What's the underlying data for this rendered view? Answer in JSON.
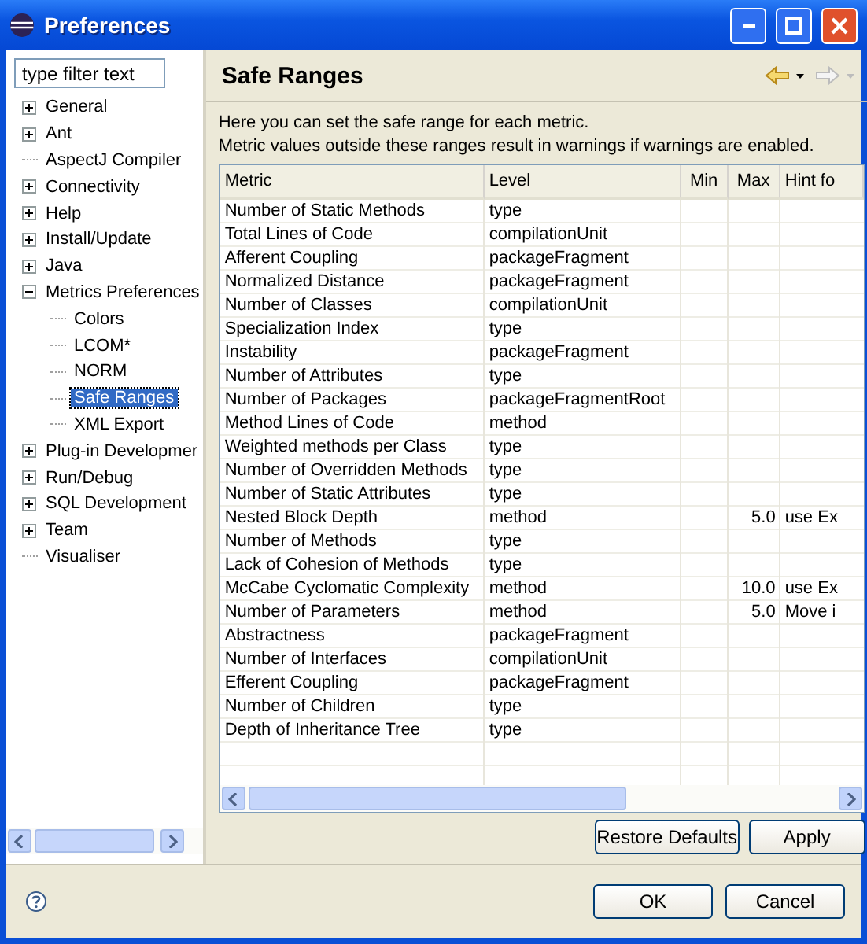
{
  "window": {
    "title": "Preferences"
  },
  "filter": {
    "placeholder": "type filter text"
  },
  "tree": [
    {
      "label": "General",
      "expanded": false,
      "selected": false
    },
    {
      "label": "Ant",
      "expanded": false,
      "selected": false
    },
    {
      "label": "AspectJ Compiler",
      "selected": false
    },
    {
      "label": "Connectivity",
      "expanded": false,
      "selected": false
    },
    {
      "label": "Help",
      "expanded": false,
      "selected": false
    },
    {
      "label": "Install/Update",
      "expanded": false,
      "selected": false
    },
    {
      "label": "Java",
      "expanded": false,
      "selected": false
    },
    {
      "label": "Metrics Preferences",
      "expanded": true,
      "selected": false,
      "children": [
        {
          "label": "Colors",
          "selected": false
        },
        {
          "label": "LCOM*",
          "selected": false
        },
        {
          "label": "NORM",
          "selected": false
        },
        {
          "label": "Safe Ranges",
          "selected": true
        },
        {
          "label": "XML Export",
          "selected": false
        }
      ]
    },
    {
      "label": "Plug-in Developmer",
      "expanded": false,
      "selected": false
    },
    {
      "label": "Run/Debug",
      "expanded": false,
      "selected": false
    },
    {
      "label": "SQL Development",
      "expanded": false,
      "selected": false
    },
    {
      "label": "Team",
      "expanded": false,
      "selected": false
    },
    {
      "label": "Visualiser",
      "selected": false
    }
  ],
  "page": {
    "title": "Safe Ranges",
    "description": [
      "Here you can set the safe range for each metric.",
      "Metric values outside these ranges result in warnings if warnings are enabled."
    ]
  },
  "table": {
    "columns": [
      "Metric",
      "Level",
      "Min",
      "Max",
      "Hint fo"
    ],
    "rows": [
      {
        "metric": "Number of Static Methods",
        "level": "type"
      },
      {
        "metric": "Total Lines of Code",
        "level": "compilationUnit"
      },
      {
        "metric": "Afferent Coupling",
        "level": "packageFragment"
      },
      {
        "metric": "Normalized Distance",
        "level": "packageFragment"
      },
      {
        "metric": "Number of Classes",
        "level": "compilationUnit"
      },
      {
        "metric": "Specialization Index",
        "level": "type"
      },
      {
        "metric": "Instability",
        "level": "packageFragment"
      },
      {
        "metric": "Number of Attributes",
        "level": "type"
      },
      {
        "metric": "Number of Packages",
        "level": "packageFragmentRoot"
      },
      {
        "metric": "Method Lines of Code",
        "level": "method"
      },
      {
        "metric": "Weighted methods per Class",
        "level": "type"
      },
      {
        "metric": "Number of Overridden Methods",
        "level": "type"
      },
      {
        "metric": "Number of Static Attributes",
        "level": "type"
      },
      {
        "metric": "Nested Block Depth",
        "level": "method",
        "max": "5.0",
        "hint": "use Ex"
      },
      {
        "metric": "Number of Methods",
        "level": "type"
      },
      {
        "metric": "Lack of Cohesion of Methods",
        "level": "type"
      },
      {
        "metric": "McCabe Cyclomatic Complexity",
        "level": "method",
        "max": "10.0",
        "hint": "use Ex"
      },
      {
        "metric": "Number of Parameters",
        "level": "method",
        "max": "5.0",
        "hint": "Move i"
      },
      {
        "metric": "Abstractness",
        "level": "packageFragment"
      },
      {
        "metric": "Number of Interfaces",
        "level": "compilationUnit"
      },
      {
        "metric": "Efferent Coupling",
        "level": "packageFragment"
      },
      {
        "metric": "Number of Children",
        "level": "type"
      },
      {
        "metric": "Depth of Inheritance Tree",
        "level": "type"
      }
    ]
  },
  "page_buttons": [
    "Restore Defaults",
    "Apply"
  ],
  "dialog_buttons": [
    "OK",
    "Cancel"
  ]
}
